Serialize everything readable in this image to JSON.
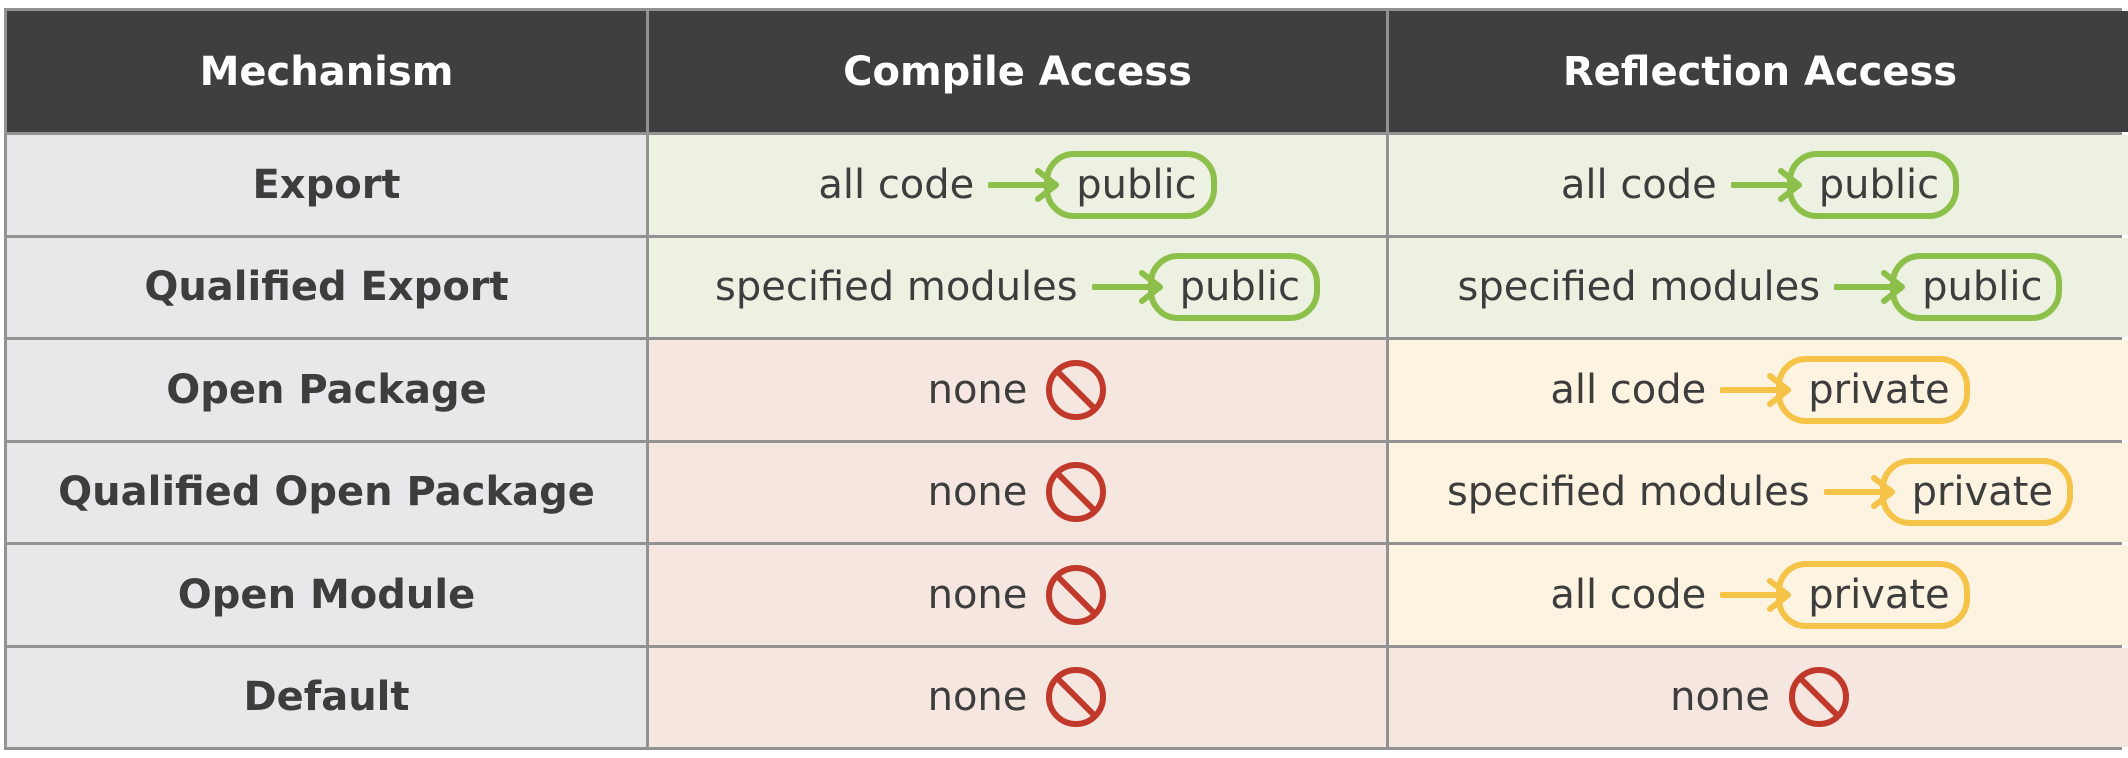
{
  "columns": [
    "Mechanism",
    "Compile Access",
    "Reflection Access"
  ],
  "rows": [
    {
      "mechanism": "Export",
      "compile": {
        "type": "grant",
        "from": "all code",
        "to": "public",
        "tone": "green"
      },
      "reflection": {
        "type": "grant",
        "from": "all code",
        "to": "public",
        "tone": "green"
      }
    },
    {
      "mechanism": "Qualified Export",
      "compile": {
        "type": "grant",
        "from": "specified modules",
        "to": "public",
        "tone": "green"
      },
      "reflection": {
        "type": "grant",
        "from": "specified modules",
        "to": "public",
        "tone": "green"
      }
    },
    {
      "mechanism": "Open Package",
      "compile": {
        "type": "deny",
        "text": "none",
        "tone": "red"
      },
      "reflection": {
        "type": "grant",
        "from": "all code",
        "to": "private",
        "tone": "amber"
      }
    },
    {
      "mechanism": "Qualified Open Package",
      "compile": {
        "type": "deny",
        "text": "none",
        "tone": "red"
      },
      "reflection": {
        "type": "grant",
        "from": "specified modules",
        "to": "private",
        "tone": "amber"
      }
    },
    {
      "mechanism": "Open Module",
      "compile": {
        "type": "deny",
        "text": "none",
        "tone": "red"
      },
      "reflection": {
        "type": "grant",
        "from": "all code",
        "to": "private",
        "tone": "amber"
      }
    },
    {
      "mechanism": "Default",
      "compile": {
        "type": "deny",
        "text": "none",
        "tone": "red"
      },
      "reflection": {
        "type": "deny",
        "text": "none",
        "tone": "red"
      }
    }
  ],
  "icons": {
    "deny": "prohibited-icon",
    "grant": "right-arrow-icon"
  },
  "colors": {
    "header_bg": "#3f3f3f",
    "mechanism_bg": "#e8e8ea",
    "green_bg": "#edf1e1",
    "red_bg": "#f6e6e0",
    "amber_bg": "#fdf3e1",
    "public_accent": "#8dc04a",
    "private_accent": "#f6c349",
    "deny_red": "#c0392b"
  }
}
